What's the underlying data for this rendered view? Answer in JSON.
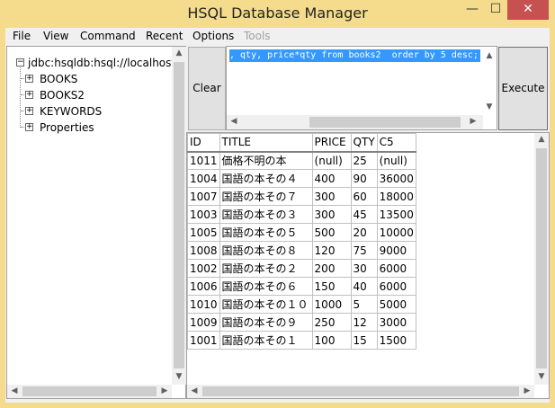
{
  "window": {
    "title": "HSQL Database Manager",
    "controls": {
      "minimize": "—",
      "maximize": "☐",
      "close": "✕"
    }
  },
  "menubar": {
    "items": [
      "File",
      "View",
      "Command",
      "Recent",
      "Options",
      "Tools"
    ]
  },
  "tree": {
    "root": "jdbc:hsqldb:hsql://localhost/",
    "nodes": [
      "BOOKS",
      "BOOKS2",
      "KEYWORDS",
      "Properties"
    ],
    "expand_glyph": "+",
    "collapse_glyph": "−"
  },
  "toolbar": {
    "clear_label": "Clear",
    "execute_label": "Execute"
  },
  "sql": {
    "text": ", qty, price*qty from books2  order by 5 desc;"
  },
  "scroll_glyphs": {
    "up": "▲",
    "down": "▼",
    "left": "◀",
    "right": "▶"
  },
  "results": {
    "columns": [
      "ID",
      "TITLE",
      "PRICE",
      "QTY",
      "C5"
    ],
    "rows": [
      [
        "1011",
        "価格不明の本",
        "(null)",
        "25",
        "(null)"
      ],
      [
        "1004",
        "国語の本その４",
        "400",
        "90",
        "36000"
      ],
      [
        "1007",
        "国語の本その７",
        "300",
        "60",
        "18000"
      ],
      [
        "1003",
        "国語の本その３",
        "300",
        "45",
        "13500"
      ],
      [
        "1005",
        "国語の本その５",
        "500",
        "20",
        "10000"
      ],
      [
        "1008",
        "国語の本その８",
        "120",
        "75",
        "9000"
      ],
      [
        "1002",
        "国語の本その２",
        "200",
        "30",
        "6000"
      ],
      [
        "1006",
        "国語の本その６",
        "150",
        "40",
        "6000"
      ],
      [
        "1010",
        "国語の本その１０",
        "1000",
        "5",
        "5000"
      ],
      [
        "1009",
        "国語の本その９",
        "250",
        "12",
        "3000"
      ],
      [
        "1001",
        "国語の本その１",
        "100",
        "15",
        "1500"
      ]
    ]
  },
  "colors": {
    "title_bar": "#f5dc8c",
    "selection": "#3399ff",
    "close_button": "#c75050"
  }
}
